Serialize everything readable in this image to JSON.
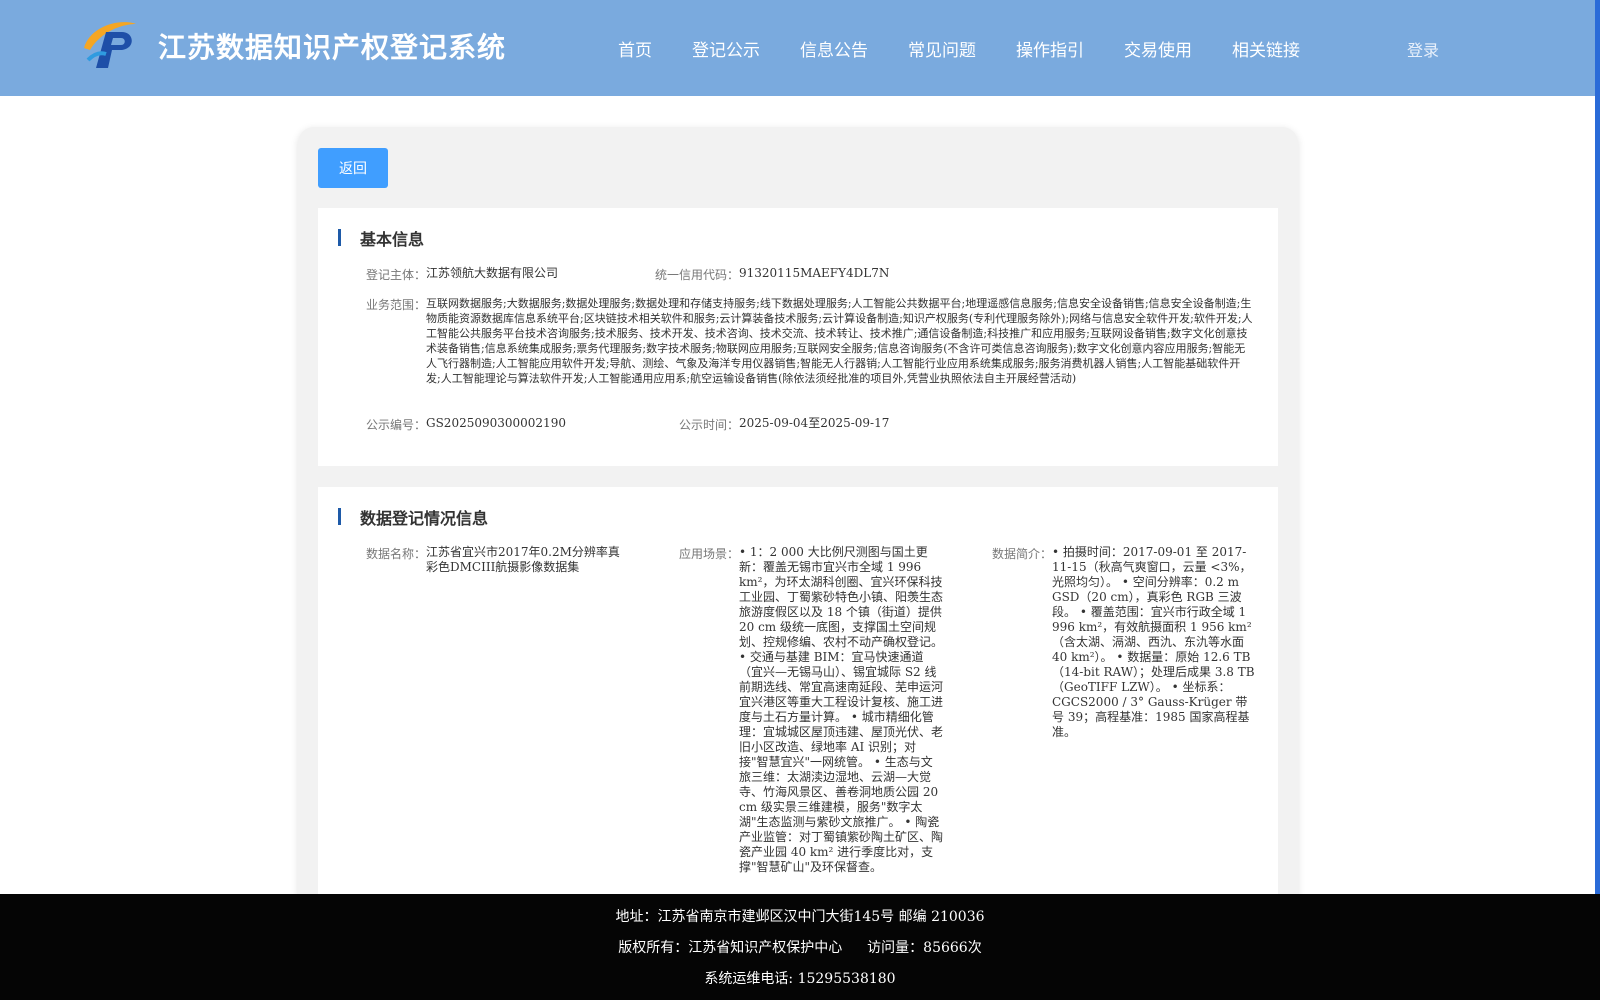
{
  "header": {
    "title": "江苏数据知识产权登记系统",
    "logo_icon": "ip-logo-icon",
    "nav": [
      "首页",
      "登记公示",
      "信息公告",
      "常见问题",
      "操作指引",
      "交易使用",
      "相关链接"
    ],
    "login_label": "登录",
    "colors": {
      "header_bg": "#7aaade",
      "accent": "#409eff"
    }
  },
  "main": {
    "back_label": "返回",
    "basic": {
      "section_title": "基本信息",
      "subject_label": "登记主体：",
      "subject_value": "江苏领航大数据有限公司",
      "credit_label": "统一信用代码：",
      "credit_value": "91320115MAEFY4DL7N",
      "scope_label": "业务范围：",
      "scope_value": "互联网数据服务;大数据服务;数据处理服务;数据处理和存储支持服务;线下数据处理服务;人工智能公共数据平台;地理遥感信息服务;信息安全设备销售;信息安全设备制造;生物质能资源数据库信息系统平台;区块链技术相关软件和服务;云计算装备技术服务;云计算设备制造;知识产权服务(专利代理服务除外);网络与信息安全软件开发;软件开发;人工智能公共服务平台技术咨询服务;技术服务、技术开发、技术咨询、技术交流、技术转让、技术推广;通信设备制造;科技推广和应用服务;互联网设备销售;数字文化创意技术装备销售;信息系统集成服务;票务代理服务;数字技术服务;物联网应用服务;互联网安全服务;信息咨询服务(不含许可类信息咨询服务);数字文化创意内容应用服务;智能无人飞行器制造;人工智能应用软件开发;导航、测绘、气象及海洋专用仪器销售;智能无人行器销;人工智能行业应用系统集成服务;服务消费机器人销售;人工智能基础软件开发;人工智能理论与算法软件开发;人工智能通用应用系;航空运输设备销售(除依法须经批准的项目外,凭营业执照依法自主开展经营活动)",
      "notice_no_label": "公示编号：",
      "notice_no_value": "GS2025090300002190",
      "notice_time_label": "公示时间：",
      "notice_time_value": "2025-09-04至2025-09-17"
    },
    "data_reg": {
      "section_title": "数据登记情况信息",
      "name_label": "数据名称：",
      "name_value": "江苏省宜兴市2017年0.2M分辨率真彩色DMCIII航摄影像数据集",
      "scene_label": "应用场景：",
      "scene_value": "• 1：2 000 大比例尺测图与国土更新：覆盖无锡市宜兴市全域 1 996 km²，为环太湖科创圈、宜兴环保科技工业园、丁蜀紫砂特色小镇、阳羡生态旅游度假区以及 18 个镇（街道）提供 20 cm 级统一底图，支撑国土空间规划、控规修编、农村不动产确权登记。 • 交通与基建 BIM：宜马快速通道（宜兴—无锡马山）、锡宜城际 S2 线前期选线、常宜高速南延段、芜申运河宜兴港区等重大工程设计复核、施工进度与土石方量计算。 • 城市精细化管理：宜城城区屋顶违建、屋顶光伏、老旧小区改造、绿地率 AI 识别；对接\"智慧宜兴\"一网统管。 • 生态与文旅三维：太湖渎边湿地、云湖—大觉寺、竹海风景区、善卷洞地质公园 20 cm 级实景三维建模，服务\"数字太湖\"生态监测与紫砂文旅推广。 • 陶瓷产业监管：对丁蜀镇紫砂陶土矿区、陶瓷产业园 40 km² 进行季度比对，支撑\"智慧矿山\"及环保督查。",
      "intro_label": "数据简介：",
      "intro_value": "• 拍摄时间：2017-09-01 至 2017-11-15（秋高气爽窗口，云量 <3%，光照均匀）。 • 空间分辨率：0.2 m GSD（20 cm），真彩色 RGB 三波段。 • 覆盖范围：宜兴市行政全域 1 996 km²，有效航摄面积 1 956 km²（含太湖、滆湖、西氿、东氿等水面 40 km²）。 • 数据量：原始 12.6 TB（14-bit RAW）；处理后成果 3.8 TB（GeoTIFF LZW）。 • 坐标系：CGCS2000 / 3° Gauss-Krüger 带号 39；高程基准：1985 国家高程基准。"
    }
  },
  "footer": {
    "address": "地址：江苏省南京市建邺区汉中门大街145号 邮编 210036",
    "copyright": "版权所有：江苏省知识产权保护中心",
    "visits": "访问量：85666次",
    "phone": "系统运维电话: 15295538180"
  }
}
